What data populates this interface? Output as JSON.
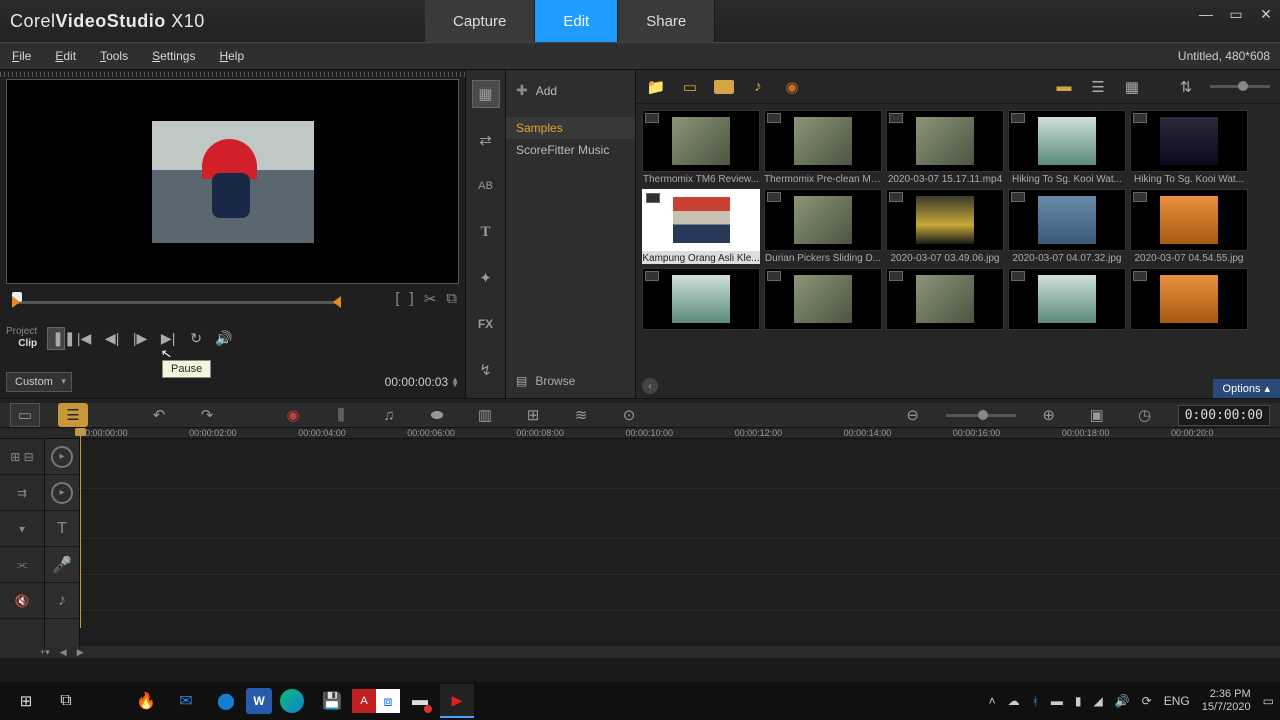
{
  "brand": {
    "pre": "Corel",
    "mid": "VideoStudio",
    "suf": "X10"
  },
  "topnav": {
    "capture": "Capture",
    "edit": "Edit",
    "share": "Share"
  },
  "menubar": {
    "file": "File",
    "edit": "Edit",
    "tools": "Tools",
    "settings": "Settings",
    "help": "Help"
  },
  "project_status": "Untitled, 480*608",
  "preview": {
    "project_label": "Project",
    "clip_label": "Clip",
    "custom": "Custom",
    "timecode": "00:00:00:03",
    "tooltip": "Pause"
  },
  "sidepanel": {
    "add": "Add",
    "samples": "Samples",
    "scorefitter": "ScoreFitter Music",
    "browse": "Browse"
  },
  "options_label": "Options",
  "library_items": [
    {
      "cap": "Thermomix TM6 Review...",
      "cls": ""
    },
    {
      "cap": "Thermomix Pre-clean Mo...",
      "cls": ""
    },
    {
      "cap": "2020-03-07 15.17.11.mp4",
      "cls": ""
    },
    {
      "cap": "Hiking To Sg. Kooi Wat...",
      "cls": "water"
    },
    {
      "cap": "Hiking To Sg. Kooi Wat...",
      "cls": "dark"
    },
    {
      "cap": "Kampung Orang Asli Kle...",
      "cls": "child",
      "sel": true
    },
    {
      "cap": "Durian Pickers Sliding D...",
      "cls": ""
    },
    {
      "cap": "2020-03-07 03.49.06.jpg",
      "cls": "van"
    },
    {
      "cap": "2020-03-07 04.07.32.jpg",
      "cls": "room"
    },
    {
      "cap": "2020-03-07 04.54.55.jpg",
      "cls": "orange"
    },
    {
      "cap": "",
      "cls": "water"
    },
    {
      "cap": "",
      "cls": ""
    },
    {
      "cap": "",
      "cls": ""
    },
    {
      "cap": "",
      "cls": "water"
    },
    {
      "cap": "",
      "cls": "orange"
    }
  ],
  "ruler": [
    "00:00:00:00",
    "00:00:02:00",
    "00:00:04:00",
    "00:00:06:00",
    "00:00:08:00",
    "00:00:10:00",
    "00:00:12:00",
    "00:00:14:00",
    "00:00:16:00",
    "00:00:18:00",
    "00:00:20:0"
  ],
  "tl_counter": "0:00:00:00",
  "tray": {
    "lang": "ENG",
    "time": "2:36 PM",
    "date": "15/7/2020"
  }
}
